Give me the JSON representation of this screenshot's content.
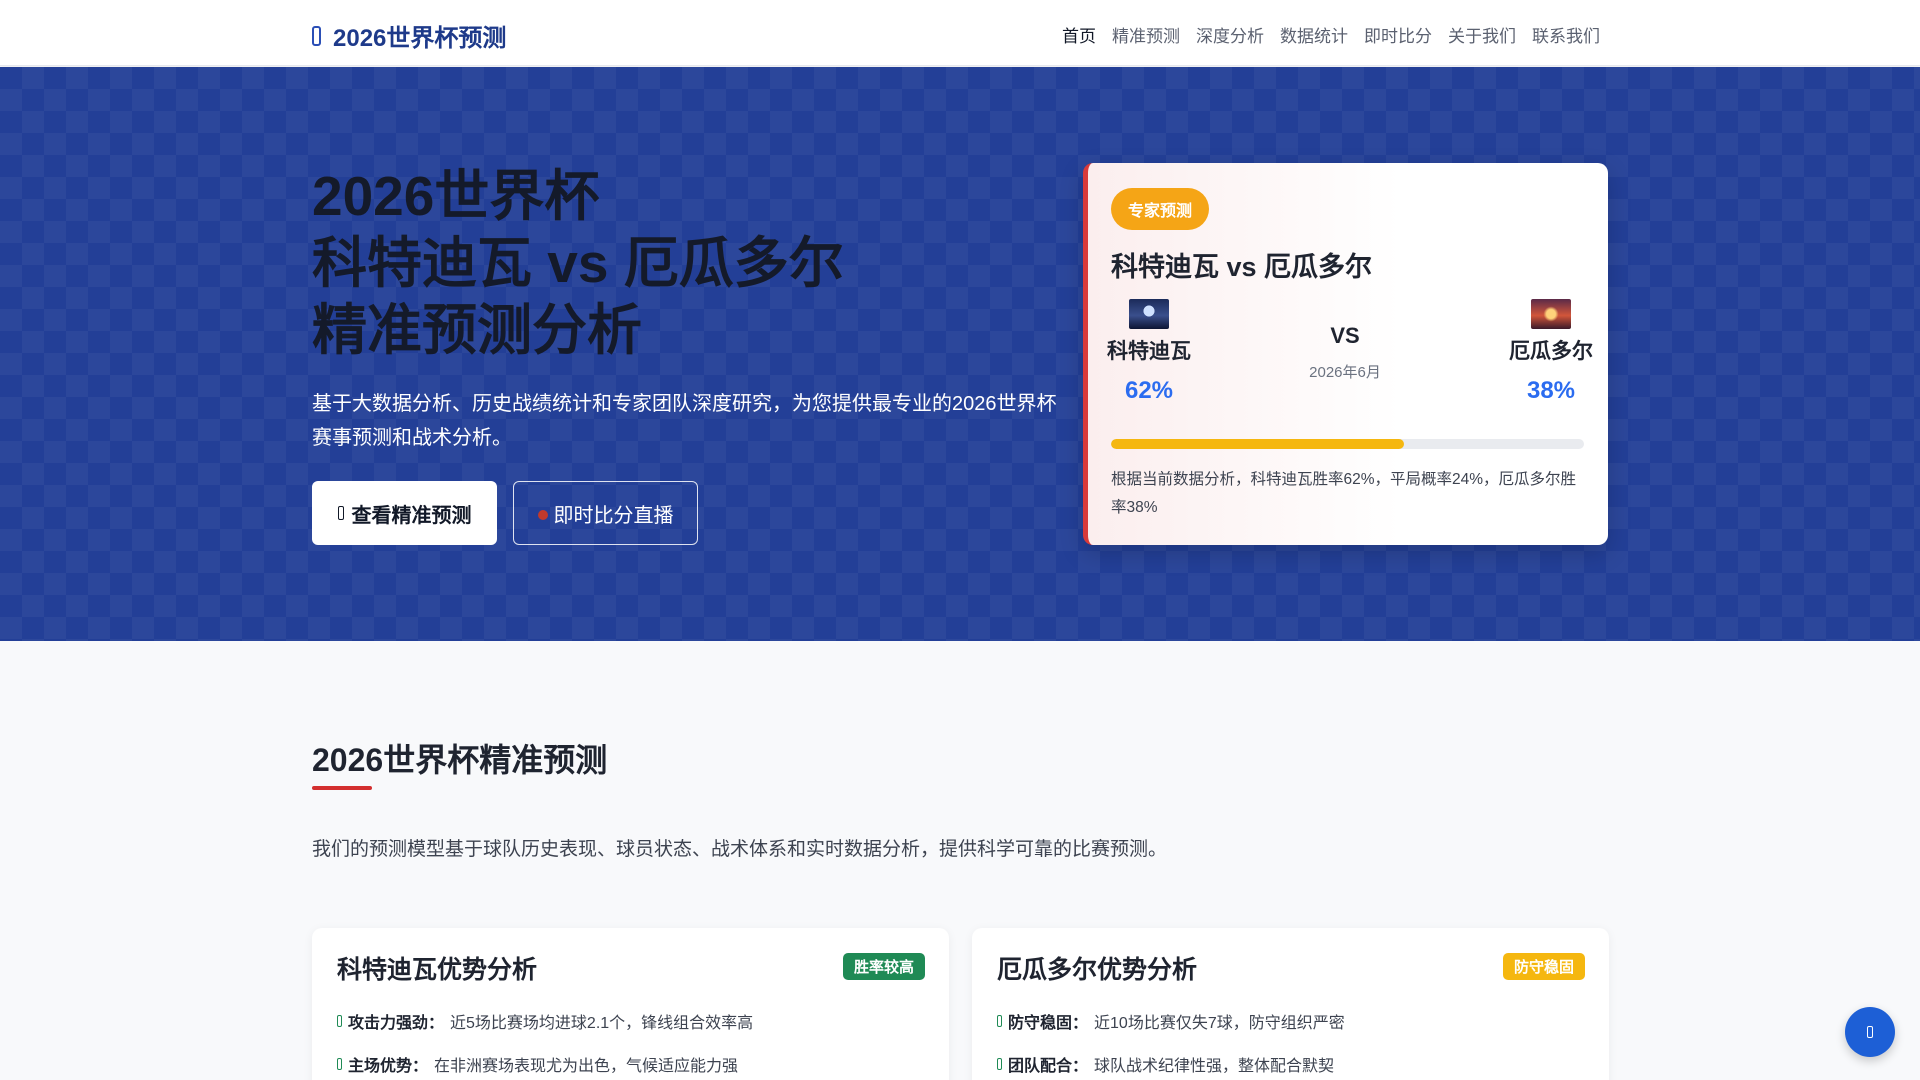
{
  "nav": {
    "brand": "2026世界杯预测",
    "links": [
      "首页",
      "精准预测",
      "深度分析",
      "数据统计",
      "即时比分",
      "关于我们",
      "联系我们"
    ]
  },
  "hero": {
    "title_lines": [
      "2026世界杯",
      "科特迪瓦 vs 厄瓜多尔",
      "精准预测分析"
    ],
    "description": "基于大数据分析、历史战绩统计和专家团队深度研究，为您提供最专业的2026世界杯赛事预测和战术分析。",
    "primary_button": "查看精准预测",
    "secondary_button": "即时比分直播"
  },
  "prediction_card": {
    "badge": "专家预测",
    "title": "科特迪瓦 vs 厄瓜多尔",
    "home_team": "科特迪瓦",
    "home_pct": "62%",
    "away_team": "厄瓜多尔",
    "away_pct": "38%",
    "vs": "VS",
    "date": "2026年6月",
    "bar_fill_fraction": 0.62,
    "note": "根据当前数据分析，科特迪瓦胜率62%，平局概率24%，厄瓜多尔胜率38%"
  },
  "section": {
    "title": "2026世界杯精准预测",
    "description": "我们的预测模型基于球队历史表现、球员状态、战术体系和实时数据分析，提供科学可靠的比赛预测。"
  },
  "analysis_cards": [
    {
      "title": "科特迪瓦优势分析",
      "tag": "胜率较高",
      "features": [
        {
          "label": "攻击力强劲：",
          "text": "近5场比赛场均进球2.1个，锋线组合效率高"
        },
        {
          "label": "主场优势：",
          "text": "在非洲赛场表现尤为出色，气候适应能力强"
        }
      ]
    },
    {
      "title": "厄瓜多尔优势分析",
      "tag": "防守稳固",
      "features": [
        {
          "label": "防守稳固：",
          "text": "近10场比赛仅失7球，防守组织严密"
        },
        {
          "label": "团队配合：",
          "text": "球队战术纪律性强，整体配合默契"
        }
      ]
    }
  ],
  "colors": {
    "hero_bg": "#233f97",
    "accent_red": "#d32f2f",
    "badge_amber": "#f5a516",
    "percent_blue": "#2b6cf0",
    "tag_green": "#1f8a55"
  },
  "icons": {
    "brand": "football-icon",
    "primary_button": "chart-icon",
    "back_to_top": "arrow-up-icon"
  }
}
